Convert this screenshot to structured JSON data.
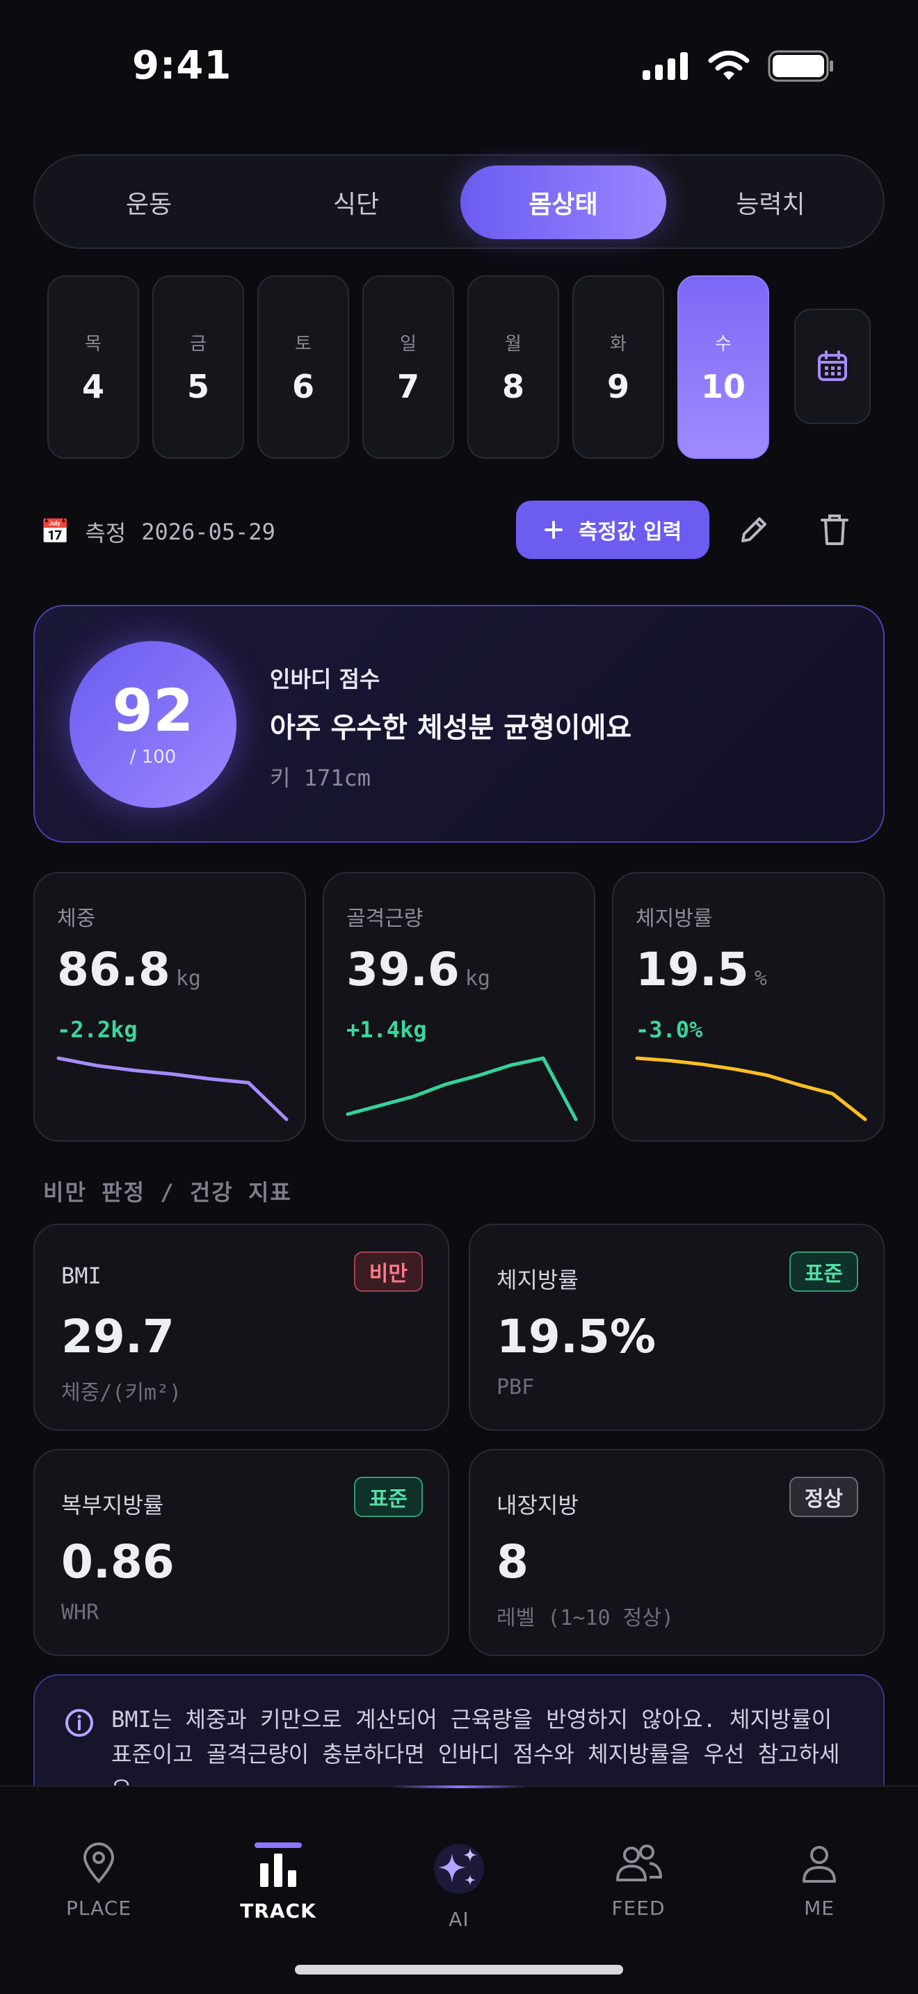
{
  "status": {
    "time": "9:41"
  },
  "tabs": [
    {
      "label": "운동",
      "active": false
    },
    {
      "label": "식단",
      "active": false
    },
    {
      "label": "몸상태",
      "active": true
    },
    {
      "label": "능력치",
      "active": false
    }
  ],
  "days": [
    {
      "weekday": "목",
      "date": "4"
    },
    {
      "weekday": "금",
      "date": "5"
    },
    {
      "weekday": "토",
      "date": "6"
    },
    {
      "weekday": "일",
      "date": "7"
    },
    {
      "weekday": "월",
      "date": "8"
    },
    {
      "weekday": "화",
      "date": "9"
    },
    {
      "weekday": "수",
      "date": "10",
      "selected": true
    }
  ],
  "measure": {
    "label": "측정",
    "date": "2026-05-29",
    "add_button": "측정값 입력",
    "calendar_emoji": "📅"
  },
  "score": {
    "value": "92",
    "max": "/ 100",
    "label": "인바디 점수",
    "message": "아주 우수한 체성분 균형이에요",
    "height": "키 171cm"
  },
  "metrics": [
    {
      "name": "체중",
      "value": "86.8",
      "unit": "kg",
      "delta": "-2.2kg",
      "color": "#a78bfa",
      "trend": [
        10,
        8.8,
        8.0,
        7.4,
        6.6,
        6.0,
        0
      ]
    },
    {
      "name": "골격근량",
      "value": "39.6",
      "unit": "kg",
      "delta": "+1.4kg",
      "color": "#34d399",
      "trend": [
        0.6,
        1.6,
        2.6,
        4.0,
        5.0,
        6.2,
        7.0,
        0
      ]
    },
    {
      "name": "체지방률",
      "value": "19.5",
      "unit": "%",
      "delta": "-3.0%",
      "color": "#fbbf24",
      "trend": [
        10,
        9.6,
        9.0,
        8.2,
        7.2,
        5.6,
        4.2,
        0
      ]
    }
  ],
  "section_title": "비만 판정 / 건강 지표",
  "indicators": [
    {
      "name": "BMI",
      "badge": "비만",
      "badge_type": "red",
      "value": "29.7",
      "sub": "체중/(키m²)"
    },
    {
      "name": "체지방률",
      "badge": "표준",
      "badge_type": "green",
      "value": "19.5%",
      "sub": "PBF"
    },
    {
      "name": "복부지방률",
      "badge": "표준",
      "badge_type": "green",
      "value": "0.86",
      "sub": "WHR"
    },
    {
      "name": "내장지방",
      "badge": "정상",
      "badge_type": "gray",
      "value": "8",
      "sub": "레벨 (1~10 정상)"
    }
  ],
  "note": {
    "text": "BMI는 체중과 키만으로 계산되어 근육량을 반영하지 않아요. 체지방률이 표준이고 골격근량이 충분하다면 인바디 점수와 체지방률을 우선 참고하세요."
  },
  "nav": [
    {
      "label": "PLACE",
      "icon": "map-pin-icon",
      "active": false
    },
    {
      "label": "TRACK",
      "icon": "bar-chart-icon",
      "active": true
    },
    {
      "label": "AI",
      "icon": "sparkle-icon",
      "active": false
    },
    {
      "label": "FEED",
      "icon": "users-icon",
      "active": false
    },
    {
      "label": "ME",
      "icon": "user-icon",
      "active": false
    }
  ],
  "colors": {
    "accent": "#6c5cf0",
    "accent_light": "#9c88ff",
    "positive": "#3ad79b"
  }
}
